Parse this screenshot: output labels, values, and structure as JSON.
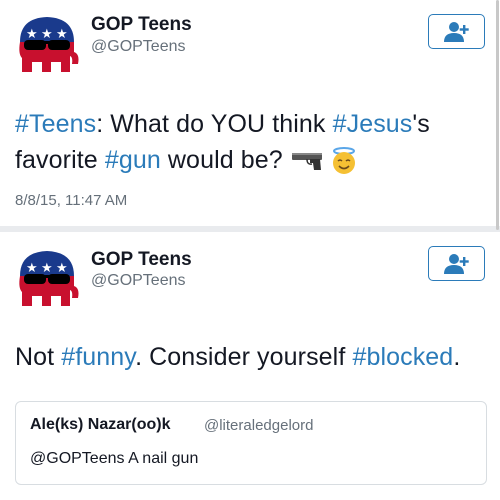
{
  "tweets": [
    {
      "name": "GOP Teens",
      "handle": "@GOPTeens",
      "text_parts": {
        "p1": "#Teens",
        "p2": ": What do YOU think ",
        "p3": "#Jesus",
        "p4": "'s",
        "p5": "favorite ",
        "p6": "#gun",
        "p7": " would be?"
      },
      "emojis": [
        "pistol-icon",
        "smiling-face-with-halo-icon"
      ],
      "timestamp": "8/8/15, 11:47 AM"
    },
    {
      "name": "GOP Teens",
      "handle": "@GOPTeens",
      "text_parts": {
        "p1": "Not ",
        "p2": "#funny",
        "p3": ". Consider yourself ",
        "p4": "#blocked",
        "p5": "."
      },
      "quote": {
        "name": "Ale(ks) Nazar(oo)k",
        "handle": "@literaledgelord",
        "text": "@GOPTeens A nail gun"
      }
    }
  ],
  "colors": {
    "hashtag": "#2b7bb9",
    "text": "#141823",
    "muted": "#66707a",
    "elephant_red": "#c8102e",
    "elephant_blue": "#1a3a8c"
  },
  "icons": {
    "follow": "add-user-icon",
    "avatar": "republican-elephant-logo"
  }
}
